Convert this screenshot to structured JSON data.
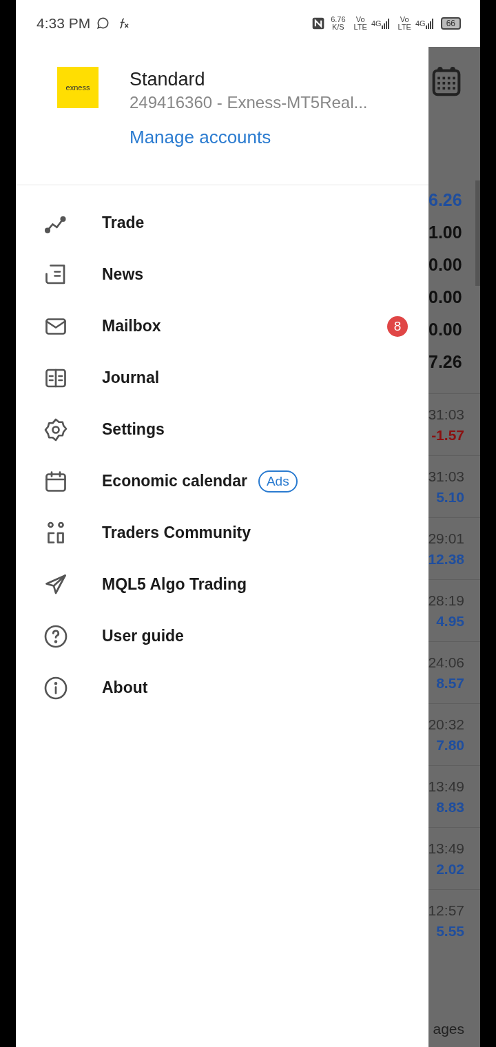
{
  "status_bar": {
    "time": "4:33 PM",
    "net_speed": "6.76",
    "net_unit": "K/S",
    "sims": [
      {
        "vo": "Vo",
        "lte": "LTE",
        "gen": "4G"
      },
      {
        "vo": "Vo",
        "lte": "LTE",
        "gen": "4G"
      }
    ],
    "battery": "66"
  },
  "account": {
    "logo": "exness",
    "name": "Standard",
    "number": "249416360 - Exness-MT5Real...",
    "manage_link": "Manage accounts"
  },
  "menu": [
    {
      "kind": "trade",
      "label": "Trade"
    },
    {
      "kind": "news",
      "label": "News"
    },
    {
      "kind": "mailbox",
      "label": "Mailbox",
      "badge": "8"
    },
    {
      "kind": "journal",
      "label": "Journal"
    },
    {
      "kind": "settings",
      "label": "Settings"
    },
    {
      "kind": "calendar",
      "label": "Economic calendar",
      "tag": "Ads"
    },
    {
      "kind": "community",
      "label": "Traders Community"
    },
    {
      "kind": "algo",
      "label": "MQL5 Algo Trading"
    },
    {
      "kind": "guide",
      "label": "User guide"
    },
    {
      "kind": "about",
      "label": "About"
    }
  ],
  "background": {
    "summary_values": [
      {
        "value": "6.26",
        "color": "#1f4e9e"
      },
      {
        "value": "1.00",
        "color": "#111111"
      },
      {
        "value": "0.00",
        "color": "#111111"
      },
      {
        "value": "0.00",
        "color": "#111111"
      },
      {
        "value": "0.00",
        "color": "#111111"
      },
      {
        "value": "7.26",
        "color": "#111111"
      }
    ],
    "history": [
      {
        "time": "31:03",
        "value": "-1.57",
        "color": "#8b1010"
      },
      {
        "time": "31:03",
        "value": "5.10",
        "color": "#1f4e9e"
      },
      {
        "time": "29:01",
        "value": "12.38",
        "color": "#1f4e9e"
      },
      {
        "time": "28:19",
        "value": "4.95",
        "color": "#1f4e9e"
      },
      {
        "time": "24:06",
        "value": "8.57",
        "color": "#1f4e9e"
      },
      {
        "time": "20:32",
        "value": "7.80",
        "color": "#1f4e9e"
      },
      {
        "time": "13:49",
        "value": "8.83",
        "color": "#1f4e9e"
      },
      {
        "time": "13:49",
        "value": "2.02",
        "color": "#1f4e9e"
      },
      {
        "time": "12:57",
        "value": "5.55",
        "color": "#1f4e9e"
      }
    ],
    "tab_label": "ages"
  }
}
